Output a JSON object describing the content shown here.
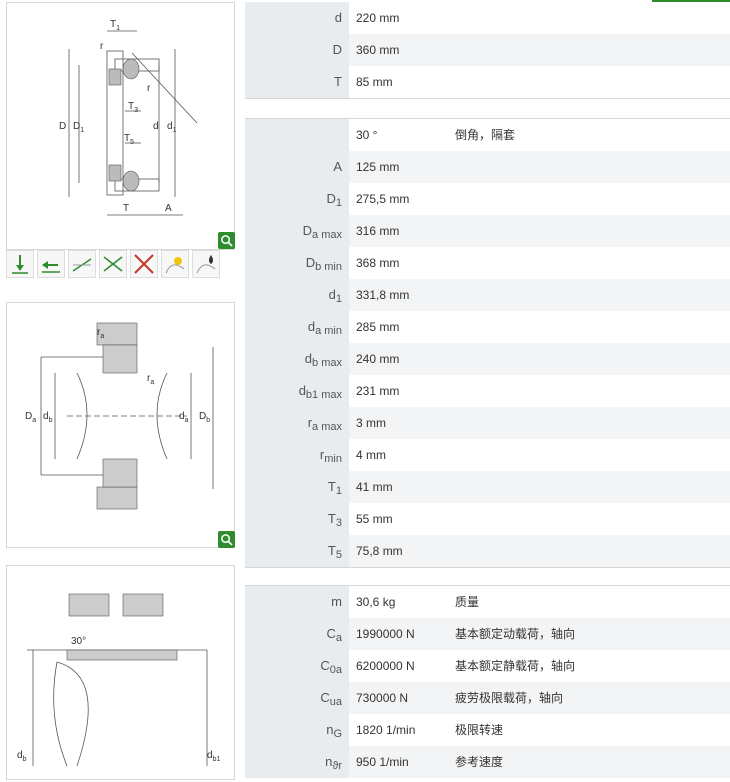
{
  "diagram_labels": {
    "d1_T1": "T",
    "d1_T1_sub": "1",
    "d1_r": "r",
    "d1_r2": "r",
    "d1_D": "D",
    "d1_D1": "D",
    "d1_D1_sub": "1",
    "d1_T3": "T",
    "d1_T3_sub": "3",
    "d1_T5": "T",
    "d1_T5_sub": "5",
    "d1_d": "d",
    "d1_d1": "d",
    "d1_d1_sub": "1",
    "d1_T": "T",
    "d1_A": "A",
    "d2_ra": "r",
    "d2_ra_sub": "a",
    "d2_ra2": "r",
    "d2_ra2_sub": "a",
    "d2_Da": "D",
    "d2_Da_sub": "a",
    "d2_db": "d",
    "d2_db_sub": "b",
    "d2_da": "d",
    "d2_da_sub": "a",
    "d2_Db": "D",
    "d2_Db_sub": "b",
    "d3_angle": "30°",
    "d3_db": "d",
    "d3_db_sub": "b",
    "d3_db1": "d",
    "d3_db1_sub": "b1"
  },
  "icons": [
    "axial-load-icon",
    "radial-load-icon",
    "misalignment-icon",
    "angular-misalignment-icon",
    "no-misalignment-icon",
    "lubrication-grease-icon",
    "lubrication-oil-icon"
  ],
  "colors": {
    "zoom": "#2e8b2e",
    "label_bg": "#e9ecee",
    "row_alt": "#f3f4f5"
  },
  "block1": [
    {
      "label": "d",
      "sub": "",
      "value": "220  mm",
      "desc": ""
    },
    {
      "label": "D",
      "sub": "",
      "value": "360  mm",
      "desc": ""
    },
    {
      "label": "T",
      "sub": "",
      "value": "85  mm",
      "desc": ""
    }
  ],
  "block2": [
    {
      "label": "",
      "sub": "",
      "value": "30  °",
      "desc": "倒角，隔套"
    },
    {
      "label": "A",
      "sub": "",
      "value": "125  mm",
      "desc": ""
    },
    {
      "label": "D",
      "sub": "1",
      "value": "275,5  mm",
      "desc": ""
    },
    {
      "label": "D",
      "sub": "a max",
      "value": "316  mm",
      "desc": ""
    },
    {
      "label": "D",
      "sub": "b min",
      "value": "368  mm",
      "desc": ""
    },
    {
      "label": "d",
      "sub": "1",
      "value": "331,8  mm",
      "desc": ""
    },
    {
      "label": "d",
      "sub": "a min",
      "value": "285  mm",
      "desc": ""
    },
    {
      "label": "d",
      "sub": "b max",
      "value": "240  mm",
      "desc": ""
    },
    {
      "label": "d",
      "sub": "b1 max",
      "value": "231  mm",
      "desc": ""
    },
    {
      "label": "r",
      "sub": "a max",
      "value": "3  mm",
      "desc": ""
    },
    {
      "label": "r",
      "sub": "min",
      "value": "4  mm",
      "desc": ""
    },
    {
      "label": "T",
      "sub": "1",
      "value": "41  mm",
      "desc": ""
    },
    {
      "label": "T",
      "sub": "3",
      "value": "55  mm",
      "desc": ""
    },
    {
      "label": "T",
      "sub": "5",
      "value": "75,8  mm",
      "desc": ""
    }
  ],
  "block3": [
    {
      "label": "m",
      "sub": "",
      "value": "30,6  kg",
      "desc": "质量"
    },
    {
      "label": "C",
      "sub": "a",
      "value": "1990000  N",
      "desc": "基本额定动载荷，轴向"
    },
    {
      "label": "C",
      "sub": "0a",
      "value": "6200000  N",
      "desc": "基本额定静载荷，轴向"
    },
    {
      "label": "C",
      "sub": "ua",
      "value": "730000  N",
      "desc": "疲劳极限载荷，轴向"
    },
    {
      "label": "n",
      "sub": "G",
      "value": "1820  1/min",
      "desc": "极限转速"
    },
    {
      "label": "n",
      "sub": "ϑr",
      "value": "950  1/min",
      "desc": "参考速度"
    }
  ]
}
